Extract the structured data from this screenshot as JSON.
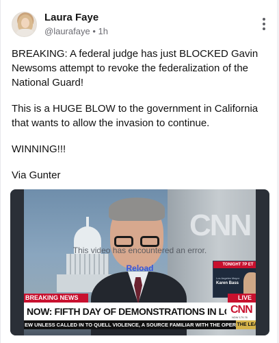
{
  "post": {
    "author_name": "Laura Faye",
    "handle": "@laurafaye",
    "separator": "•",
    "time": "1h",
    "more_icon": "more-vertical-icon",
    "paragraphs": [
      "BREAKING: A federal judge has just BLOCKED Gavin Newsoms attempt to revoke the federalization of the National Guard!",
      "This is a HUGE BLOW to the government in California that wants to allow the invasion to continue.",
      "WINNING!!!",
      "Via Gunter"
    ]
  },
  "video": {
    "error_message": "This video has encountered an error.",
    "reload_label": "Reload",
    "background_logo": "CNN",
    "inset": {
      "tag": "TONIGHT 7P ET",
      "subtitle": "Los Angeles Mayor",
      "name": "Karen Bass"
    },
    "breaking_tag": "BREAKING NEWS",
    "live_tag": "LIVE",
    "headline": "NOW: FIFTH DAY OF DEMONSTRATIONS IN LOS ANGELES",
    "logo_text": "CNN",
    "logo_ticker": "NDW  179.76",
    "ticker": "EW UNLESS CALLED IN TO QUELL VIOLENCE, A SOURCE FAMILIAR WITH THE OPERATIC",
    "show_tag": "THE LEAD"
  },
  "colors": {
    "accent_red": "#c8102e",
    "link_blue": "#3a54d8",
    "muted_text": "#6b6b72"
  }
}
